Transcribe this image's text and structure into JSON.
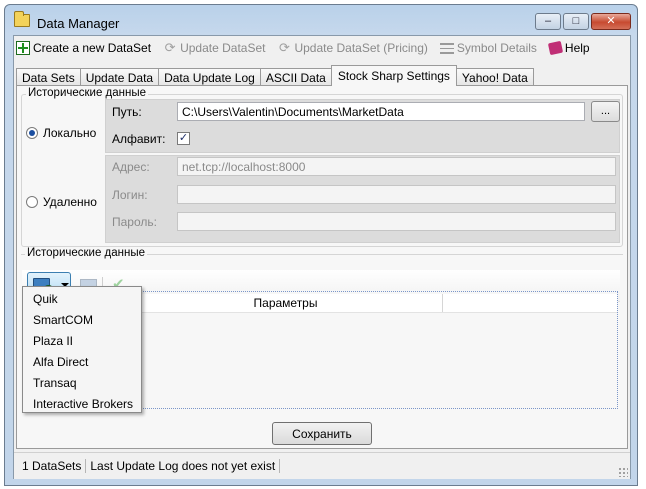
{
  "window": {
    "title": "Data Manager"
  },
  "toolbar": {
    "create": "Create a new DataSet",
    "update": "Update DataSet",
    "update_pricing": "Update DataSet (Pricing)",
    "symbol_details": "Symbol Details",
    "help": "Help"
  },
  "tabs": [
    {
      "label": "Data Sets",
      "active": false
    },
    {
      "label": "Update Data",
      "active": false
    },
    {
      "label": "Data Update Log",
      "active": false
    },
    {
      "label": "ASCII Data",
      "active": false
    },
    {
      "label": "Stock Sharp Settings",
      "active": true
    },
    {
      "label": "Yahoo! Data",
      "active": false
    }
  ],
  "history": {
    "title": "Исторические данные",
    "local_label": "Локально",
    "local_selected": true,
    "path_label": "Путь:",
    "path_value": "C:\\Users\\Valentin\\Documents\\MarketData",
    "browse_label": "...",
    "alphabet_label": "Алфавит:",
    "alphabet_checked": true,
    "remote_label": "Удаленно",
    "remote_selected": false,
    "address_label": "Адрес:",
    "address_value": "net.tcp://localhost:8000",
    "login_label": "Логин:",
    "login_value": "",
    "password_label": "Пароль:",
    "password_value": ""
  },
  "connections": {
    "title": "Исторические данные",
    "grid_headers": [
      "",
      "Параметры",
      ""
    ],
    "dropdown_items": [
      "Quik",
      "SmartCOM",
      "Plaza II",
      "Alfa Direct",
      "Transaq",
      "Interactive Brokers"
    ]
  },
  "save_label": "Сохранить",
  "status": {
    "datasets": "1 DataSets",
    "log": "Last Update Log does not yet exist"
  }
}
